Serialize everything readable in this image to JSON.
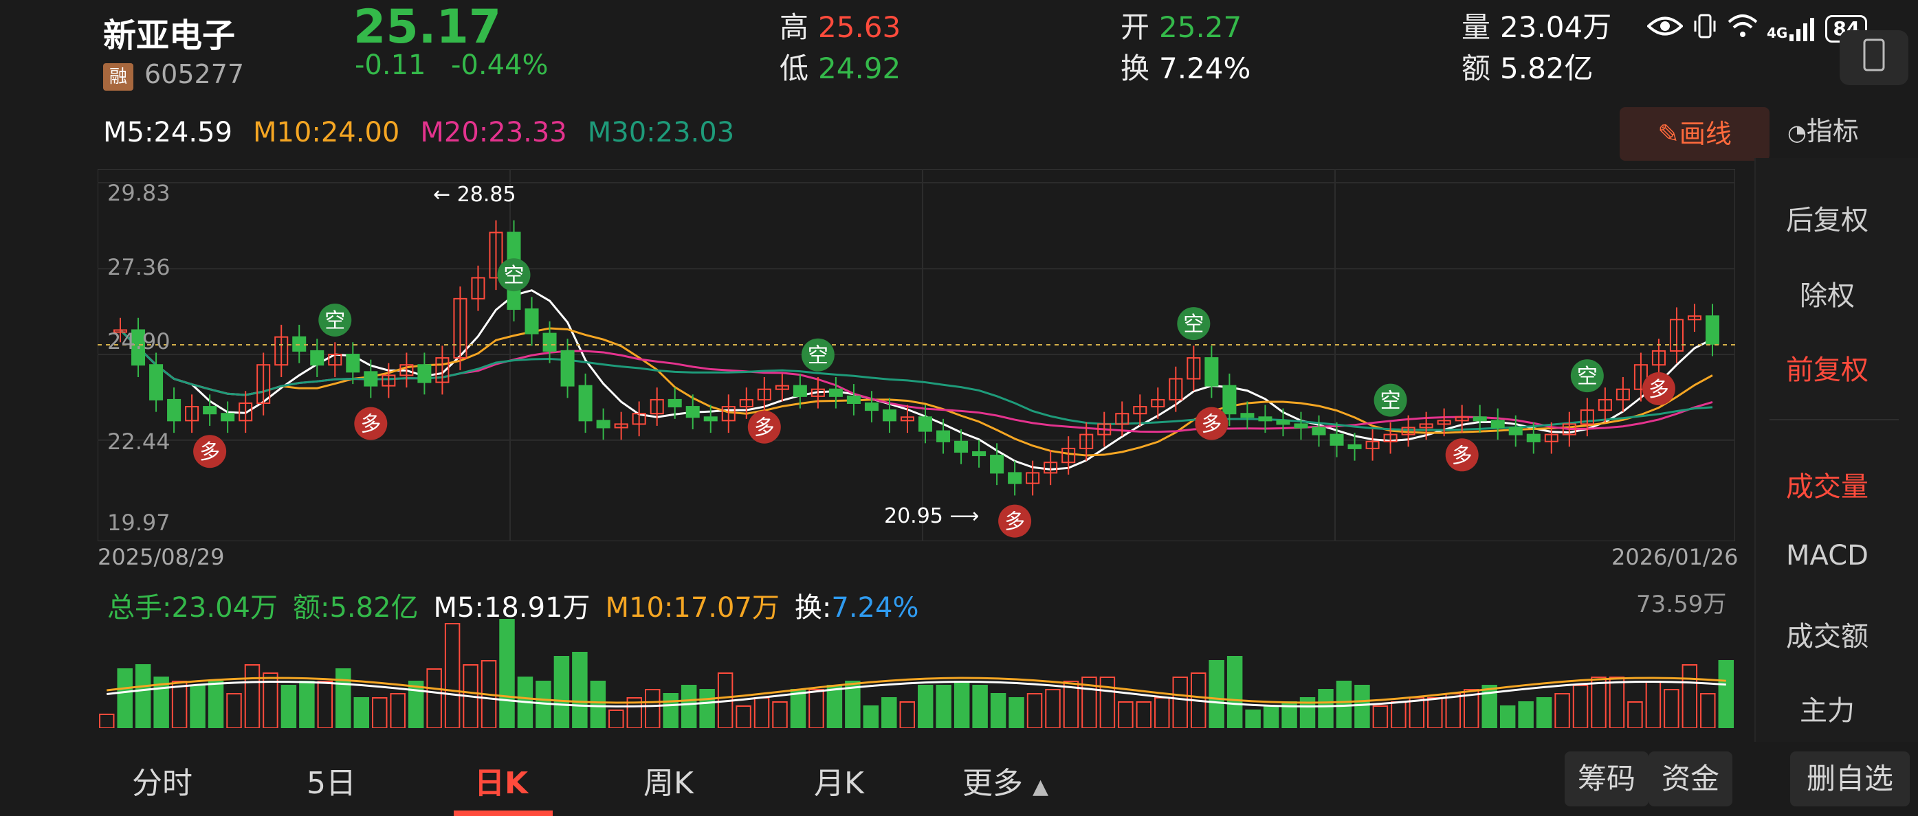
{
  "stock": {
    "name": "新亚电子",
    "badge": "融",
    "code": "605277",
    "price": "25.17",
    "change_abs": "-0.11",
    "change_pct": "-0.44%",
    "high_label": "高",
    "high": "25.63",
    "low_label": "低",
    "low": "24.92",
    "open_label": "开",
    "open": "25.27",
    "turnover_label": "换",
    "turnover": "7.24%",
    "volume_label": "量",
    "volume": "23.04万",
    "amount_label": "额",
    "amount": "5.82亿"
  },
  "status_bar": {
    "signal": "4G",
    "battery": "84"
  },
  "ma_legend": {
    "m5": "M5:24.59",
    "m10": "M10:24.00",
    "m20": "M20:23.33",
    "m30": "M30:23.03"
  },
  "toolbar": {
    "draw_label": "画线",
    "indicator_label": "指标"
  },
  "chart": {
    "y_ticks": [
      "29.83",
      "27.36",
      "24.90",
      "22.44",
      "19.97"
    ],
    "start_date": "2025/08/29",
    "end_date": "2026/01/26",
    "high_marker": "28.85",
    "low_marker": "20.95",
    "signal_long": "多",
    "signal_short": "空"
  },
  "volume_panel": {
    "total": "总手:23.04万",
    "amount": "额:5.82亿",
    "m5": "M5:18.91万",
    "m10": "M10:17.07万",
    "turnover_label": "换:",
    "turnover": "7.24%",
    "max": "73.59万"
  },
  "right_panel": {
    "items": [
      "后复权",
      "除权",
      "前复权",
      "成交量",
      "MACD",
      "成交额",
      "主力"
    ]
  },
  "tabs": {
    "items": [
      "分时",
      "5日",
      "日K",
      "周K",
      "月K",
      "更多"
    ],
    "chips_btn": "筹码",
    "funds_btn": "资金",
    "remove_btn": "删自选"
  },
  "chart_data": {
    "type": "candlestick",
    "x_range": [
      "2025/08/29",
      "2026/01/26"
    ],
    "ylim": [
      19.97,
      29.83
    ],
    "y_ticks": [
      29.83,
      27.36,
      24.9,
      22.44,
      19.97
    ],
    "annotations": [
      {
        "label": "28.85",
        "kind": "high"
      },
      {
        "label": "20.95",
        "kind": "low"
      }
    ],
    "series": [
      {
        "name": "M5",
        "value": 24.59,
        "color": "#ffffff"
      },
      {
        "name": "M10",
        "value": 24.0,
        "color": "#f5a623"
      },
      {
        "name": "M20",
        "value": 23.33,
        "color": "#e4338e"
      },
      {
        "name": "M30",
        "value": 23.03,
        "color": "#1e9b7a"
      }
    ],
    "volume": {
      "max": "73.59万",
      "series": [
        {
          "name": "M5",
          "value": "18.91万",
          "color": "#ffffff"
        },
        {
          "name": "M10",
          "value": "17.07万",
          "color": "#f5a623"
        }
      ]
    }
  }
}
